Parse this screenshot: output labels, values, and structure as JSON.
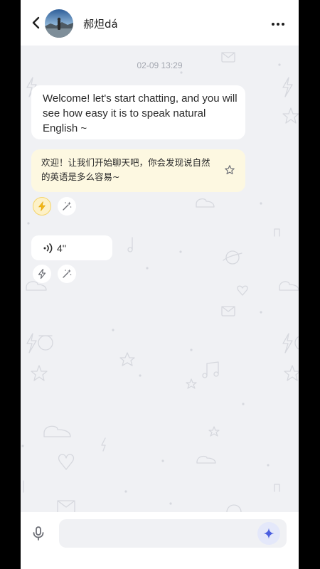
{
  "header": {
    "title": "郝炟dá",
    "back_icon": "chevron-left-icon",
    "more_icon": "more-horizontal-icon"
  },
  "chat": {
    "timestamp": "02-09 13:29",
    "messages": [
      {
        "english": "Welcome! let's start chatting, and you will see how easy it is to speak natural English ~",
        "translation": "欢迎！让我们开始聊天吧，你会发现说自然的英语是多么容易~",
        "translation_icon": "star-outline-icon",
        "actions": [
          "lightning-icon",
          "magic-wand-icon"
        ]
      },
      {
        "voice_duration": "4''",
        "voice_icon": "sound-wave-icon",
        "actions": [
          "lightning-icon",
          "magic-wand-icon"
        ]
      }
    ]
  },
  "composer": {
    "mic_icon": "microphone-icon",
    "input_value": "",
    "input_placeholder": "",
    "send_icon": "sparkle-icon"
  },
  "colors": {
    "background": "#f0f1f4",
    "translation_bubble": "#fdf8e1",
    "accent_yellow": "#f2b615",
    "accent_blue": "#4b5fe0"
  }
}
